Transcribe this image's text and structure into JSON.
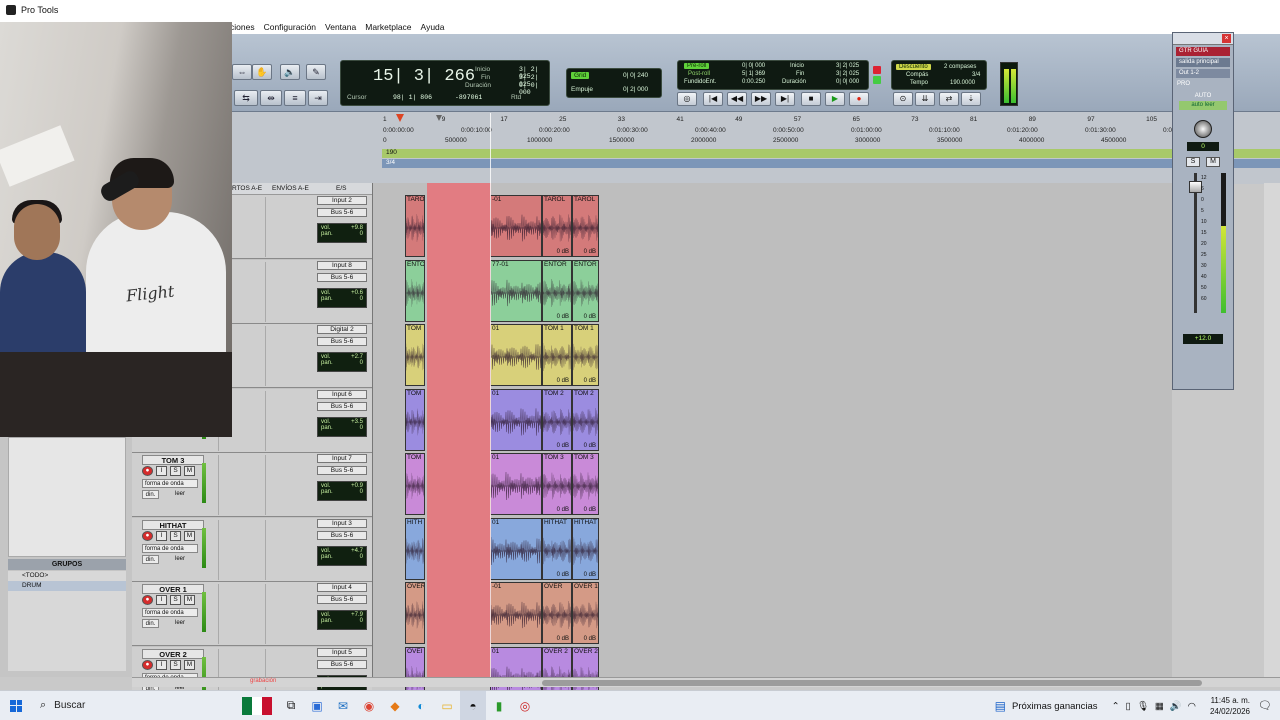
{
  "window": {
    "title": "Pro Tools"
  },
  "menu": [
    "ciones",
    "Configuración",
    "Ventana",
    "Marketplace",
    "Ayuda"
  ],
  "counter": {
    "main": "15| 3| 266",
    "cursor_label": "Cursor",
    "cursor_value": "98| 1| 806",
    "cursor_extra": "-897061",
    "rtd": "Rtd",
    "inicio_label": "Inicio",
    "inicio_value": "3| 2| 025",
    "fin_label": "Fin",
    "fin_value": "3| 2| 025",
    "duracion_label": "Duración",
    "duracion_value": "0| 0| 000"
  },
  "grid": {
    "grid_label": "Grid",
    "grid_value": "0| 0| 240",
    "nudge_label": "Empuje",
    "nudge_value": "0| 2| 000"
  },
  "preroll": {
    "preroll_label": "Pre-roll",
    "preroll_value": "0| 0| 000",
    "postroll_label": "Post-roll",
    "postroll_value": "5| 1| 369",
    "fundido_label": "FundidoEnt.",
    "fundido_value": "0:00.250",
    "inicio_label": "Inicio",
    "inicio_value": "3| 2| 025",
    "fin_label": "Fin",
    "fin_value": "3| 2| 025",
    "dur_label": "Duración",
    "dur_value": "0| 0| 000"
  },
  "countoff": {
    "label": "Descuento",
    "bars": "2 compases",
    "compas_label": "Compás",
    "compas_value": "3/4",
    "tempo_label": "Tempo",
    "tempo_value": "190.0000"
  },
  "ruler": {
    "bars": [
      "1",
      "9",
      "17",
      "25",
      "33",
      "41",
      "49",
      "57",
      "65",
      "73",
      "81",
      "89",
      "97",
      "105"
    ],
    "times": [
      "0:00:00:00",
      "0:00:10:00",
      "0:00:20:00",
      "0:00:30:00",
      "0:00:40:00",
      "0:00:50:00",
      "0:01:00:00",
      "0:01:10:00",
      "0:01:20:00",
      "0:01:30:00",
      "0:01"
    ],
    "samples": [
      "0",
      "500000",
      "1000000",
      "1500000",
      "2000000",
      "2500000",
      "3000000",
      "3500000",
      "4000000",
      "4500000"
    ],
    "tempo_marker": "190",
    "meter_marker": "3/4"
  },
  "headers": {
    "inserts": "RTOS A-E",
    "sends": "ENVÍOS A-E",
    "io": "E/S"
  },
  "tracks": [
    {
      "name": "",
      "input": "Input 2",
      "bus": "Bus 5-6",
      "vol": "+9.8",
      "pan": "0",
      "color": "#d47a7a",
      "clips": [
        "TARO",
        "-01",
        "TAROL",
        "TAROL"
      ]
    },
    {
      "name": "",
      "input": "Input 8",
      "bus": "Bus 5-6",
      "vol": "+0.6",
      "pan": "0",
      "color": "#8ccf9a",
      "clips": [
        "ENTO",
        "77-01",
        "ENTOR",
        "ENTOR"
      ]
    },
    {
      "name": "",
      "input": "Digital 2",
      "bus": "Bus 5-6",
      "vol": "+2.7",
      "pan": "0",
      "color": "#d8d07a",
      "clips": [
        "TOM",
        "01",
        "TOM 1",
        "TOM 1"
      ]
    },
    {
      "name": "",
      "input": "Input 6",
      "bus": "Bus 5-6",
      "vol": "+3.5",
      "pan": "0",
      "color": "#9b8ce0",
      "clips": [
        "TOM",
        "01",
        "TOM 2",
        "TOM 2"
      ]
    },
    {
      "name": "TOM 3",
      "input": "Input 7",
      "bus": "Bus 5-6",
      "vol": "+0.9",
      "pan": "0",
      "color": "#c98ad8",
      "clips": [
        "TOM",
        "01",
        "TOM 3",
        "TOM 3"
      ]
    },
    {
      "name": "HITHAT",
      "input": "Input 3",
      "bus": "Bus 5-6",
      "vol": "+4.7",
      "pan": "0",
      "color": "#88a8dc",
      "clips": [
        "HITH",
        "01",
        "HITHAT",
        "HITHAT"
      ]
    },
    {
      "name": "OVER 1",
      "input": "Input 4",
      "bus": "Bus 5-6",
      "vol": "+7.9",
      "pan": "0",
      "color": "#d49a86",
      "clips": [
        "OVER",
        "-01",
        "OVER",
        "OVER 1"
      ]
    },
    {
      "name": "OVER 2",
      "input": "Input 5",
      "bus": "Bus 5-6",
      "vol": "",
      "pan": "",
      "color": "#b88ae0",
      "clips": [
        "OVEI",
        "01",
        "OVER 2",
        "OVER 2"
      ]
    }
  ],
  "track_labels": {
    "view": "forma de onda",
    "auto": "din.",
    "auto_mode": "leer",
    "vol": "vol.",
    "pan": "pan.",
    "gain": "0 dB",
    "rec": "●",
    "input_mon": "I",
    "solo": "S",
    "mute": "M"
  },
  "groups": {
    "title": "GRUPOS",
    "items": [
      "<TODO>",
      "DRUM"
    ]
  },
  "mixer_strip": {
    "track": "GTR GUIA",
    "output": "salida principal",
    "out_sel": "Out 1-2",
    "pro": "PRO",
    "auto_label": "AUTO",
    "auto_mode": "auto leer",
    "pan_value": "0",
    "solo": "S",
    "mute": "M",
    "vol": "+12.0",
    "scale": [
      "12",
      "6",
      "0",
      "5",
      "10",
      "15",
      "20",
      "25",
      "30",
      "40",
      "50",
      "60"
    ],
    "meter_level": 0.62
  },
  "status": {
    "grabacion": "grabación"
  },
  "video": {
    "shirt_text": "Flight"
  },
  "taskbar": {
    "search": "Buscar",
    "news": "Próximas ganancias",
    "time": "11:45 a. m.",
    "date": "24/02/2026"
  }
}
